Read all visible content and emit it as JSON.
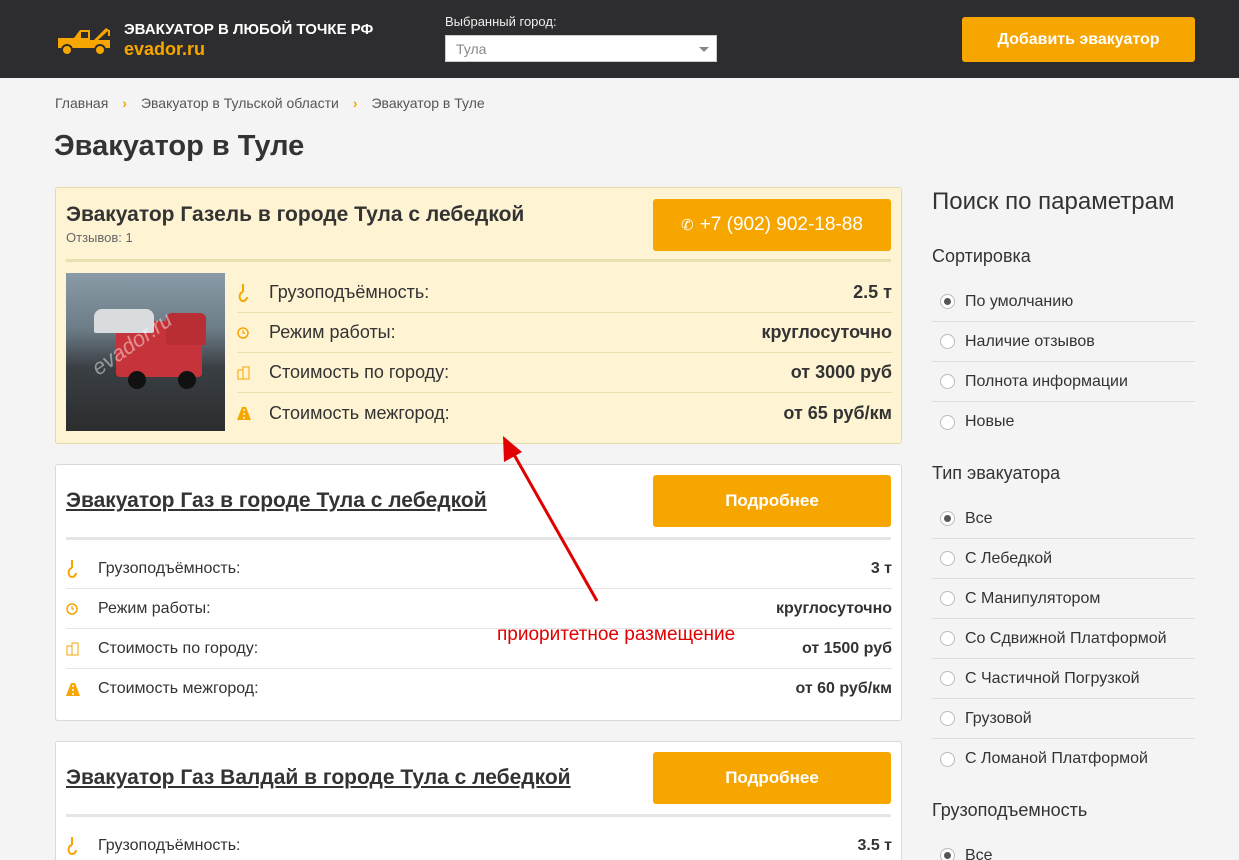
{
  "header": {
    "logo_title": "ЭВАКУАТОР В ЛЮБОЙ ТОЧКЕ РФ",
    "logo_domain": "evador.ru",
    "city_label": "Выбранный город:",
    "city_value": "Тула",
    "add_button": "Добавить эвакуатор"
  },
  "breadcrumb": [
    "Главная",
    "Эвакуатор в Тульской области",
    "Эвакуатор в Туле"
  ],
  "page_title": "Эвакуатор в Туле",
  "listings": [
    {
      "title": "Эвакуатор Газель в городе Тула с лебедкой",
      "reviews": "Отзывов: 1",
      "button": "+7 (902) 902-18-88",
      "watermark": "evador.ru",
      "rows": [
        {
          "icon": "hook-icon",
          "label": "Грузоподъёмность:",
          "value": "2.5 т"
        },
        {
          "icon": "clock-icon",
          "label": "Режим работы:",
          "value": "круглосуточно"
        },
        {
          "icon": "city-icon",
          "label": "Стоимость по городу:",
          "value": "от 3000 руб"
        },
        {
          "icon": "road-icon",
          "label": "Стоимость межгород:",
          "value": "от 65 руб/км"
        }
      ]
    },
    {
      "title": "Эвакуатор Газ в городе Тула с лебедкой",
      "button": "Подробнее",
      "rows": [
        {
          "icon": "hook-icon",
          "label": "Грузоподъёмность:",
          "value": "3 т"
        },
        {
          "icon": "clock-icon",
          "label": "Режим работы:",
          "value": "круглосуточно"
        },
        {
          "icon": "city-icon",
          "label": "Стоимость по городу:",
          "value": "от 1500 руб"
        },
        {
          "icon": "road-icon",
          "label": "Стоимость межгород:",
          "value": "от 60 руб/км"
        }
      ]
    },
    {
      "title": "Эвакуатор Газ Валдай в городе Тула с лебедкой",
      "button": "Подробнее",
      "rows": [
        {
          "icon": "hook-icon",
          "label": "Грузоподъёмность:",
          "value": "3.5 т"
        }
      ]
    }
  ],
  "sidebar": {
    "title": "Поиск по параметрам",
    "sort": {
      "heading": "Сортировка",
      "options": [
        "По умолчанию",
        "Наличие отзывов",
        "Полнота информации",
        "Новые"
      ],
      "selected": 0
    },
    "type": {
      "heading": "Тип эвакуатора",
      "options": [
        "Все",
        "С Лебедкой",
        "С Манипулятором",
        "Со Сдвижной Платформой",
        "С Частичной Погрузкой",
        "Грузовой",
        "С Ломаной Платформой"
      ],
      "selected": 0
    },
    "capacity": {
      "heading": "Грузоподъемность",
      "options": [
        "Все"
      ],
      "selected": 0
    }
  },
  "annotation": {
    "text": "приоритетное размещение",
    "color": "#e00000"
  },
  "colors": {
    "accent": "#f7a600",
    "header_bg": "#2d2d2f",
    "featured_bg": "#fef4d3"
  }
}
